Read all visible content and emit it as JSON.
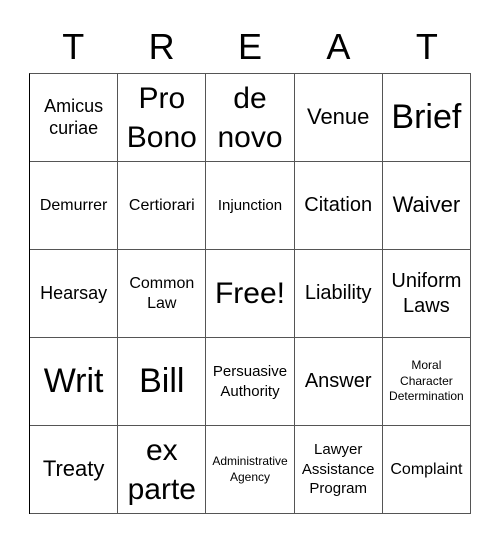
{
  "title_letters": [
    "T",
    "R",
    "E",
    "A",
    "T"
  ],
  "cells": [
    [
      "Amicus curiae",
      "Pro Bono",
      "de novo",
      "Venue",
      "Brief"
    ],
    [
      "Demurrer",
      "Certiorari",
      "Injunction",
      "Citation",
      "Waiver"
    ],
    [
      "Hearsay",
      "Common Law",
      "Free!",
      "Liability",
      "Uniform Laws"
    ],
    [
      "Writ",
      "Bill",
      "Persuasive Authority",
      "Answer",
      "Moral Character Determination"
    ],
    [
      "Treaty",
      "ex parte",
      "Administrative Agency",
      "Lawyer Assistance Program",
      "Complaint"
    ]
  ]
}
